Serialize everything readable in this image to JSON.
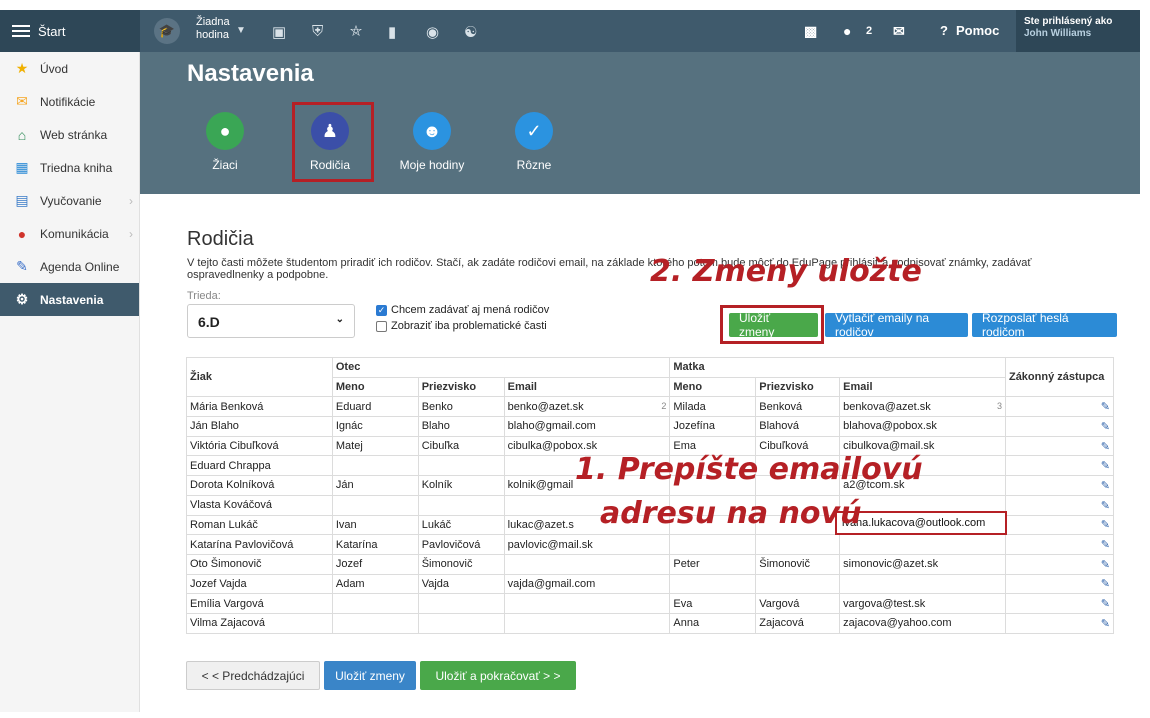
{
  "topbar": {
    "menu_label": "Štart",
    "hodina_line1": "Žiadna",
    "hodina_line2": "hodina",
    "messages_count": "2",
    "help_label": "Pomoc",
    "user_label": "Ste prihlásený ako",
    "user_name": "John Williams"
  },
  "sidebar": {
    "items": [
      {
        "label": "Úvod"
      },
      {
        "label": "Notifikácie"
      },
      {
        "label": "Web stránka"
      },
      {
        "label": "Triedna kniha"
      },
      {
        "label": "Vyučovanie"
      },
      {
        "label": "Komunikácia"
      },
      {
        "label": "Agenda Online"
      },
      {
        "label": "Nastavenia"
      }
    ]
  },
  "settings": {
    "title": "Nastavenia",
    "tabs": [
      {
        "label": "Žiaci"
      },
      {
        "label": "Rodičia"
      },
      {
        "label": "Moje hodiny"
      },
      {
        "label": "Rôzne"
      }
    ]
  },
  "content": {
    "heading": "Rodičia",
    "description": "V tejto časti môžete študentom priradiť ich rodičov. Stačí, ak zadáte rodičovi email, na základe ktorého potom bude môcť do EduPage prihlásiť a podpisovať známky, zadávať ospravedlnenky a podpobne.",
    "class_label": "Trieda:",
    "class_value": "6.D",
    "checkbox1": "Chcem zadávať aj mená rodičov",
    "checkbox2": "Zobraziť iba problematické časti",
    "btn_save": "Uložiť zmeny",
    "btn_print": "Vytlačiť emaily na rodičov",
    "btn_send": "Rozposlať heslá rodičom",
    "btn_prev": "< < Predchádzajúci",
    "btn_save_bottom": "Uložiť zmeny",
    "btn_save_continue": "Uložiť a pokračovať > >"
  },
  "table": {
    "h_student": "Žiak",
    "h_father": "Otec",
    "h_mother": "Matka",
    "h_guardian": "Zákonný zástupca",
    "h_name": "Meno",
    "h_surname": "Priezvisko",
    "h_email": "Email",
    "rows": [
      {
        "student": "Mária Benková",
        "f_name": "Eduard",
        "f_surname": "Benko",
        "f_email": "benko@azet.sk",
        "f_count": "2",
        "m_name": "Milada",
        "m_surname": "Benková",
        "m_email": "benkova@azet.sk",
        "m_count": "3"
      },
      {
        "student": "Ján Blaho",
        "f_name": "Ignác",
        "f_surname": "Blaho",
        "f_email": "blaho@gmail.com",
        "m_name": "Jozefína",
        "m_surname": "Blahová",
        "m_email": "blahova@pobox.sk"
      },
      {
        "student": "Viktória Cibuľková",
        "f_name": "Matej",
        "f_surname": "Cibuľka",
        "f_email": "cibulka@pobox.sk",
        "m_name": "Ema",
        "m_surname": "Cibuľková",
        "m_email": "cibulkova@mail.sk"
      },
      {
        "student": "Eduard Chrappa"
      },
      {
        "student": "Dorota Kolníková",
        "f_name": "Ján",
        "f_surname": "Kolník",
        "f_email": "kolnik@gmail",
        "m_email": "a2@tcom.sk"
      },
      {
        "student": "Vlasta Kováčová"
      },
      {
        "student": "Roman Lukáč",
        "f_name": "Ivan",
        "f_surname": "Lukáč",
        "f_email": "lukac@azet.s"
      },
      {
        "student": "Katarína Pavlovičová",
        "f_name": "Katarína",
        "f_surname": "Pavlovičová",
        "f_email": "pavlovic@mail.sk"
      },
      {
        "student": "Oto Šimonovič",
        "f_name": "Jozef",
        "f_surname": "Šimonovič",
        "m_name": "Peter",
        "m_surname": "Šimonovič",
        "m_email": "simonovic@azet.sk"
      },
      {
        "student": "Jozef Vajda",
        "f_name": "Adam",
        "f_surname": "Vajda",
        "f_email": "vajda@gmail.com"
      },
      {
        "student": "Emília Vargová",
        "m_name": "Eva",
        "m_surname": "Vargová",
        "m_email": "vargova@test.sk"
      },
      {
        "student": "Vilma Zajacová",
        "m_name": "Anna",
        "m_surname": "Zajacová",
        "m_email": "zajacova@yahoo.com"
      }
    ],
    "edited_email": "ivana.lukacova@outlook.com"
  },
  "annotations": {
    "step2": "2. Zmeny uložte",
    "step1_line1": "1. Prepíšte emailovú",
    "step1_line2": "adresu na novú"
  },
  "colors": {
    "topbar": "#3f5a6c",
    "header": "#56717f",
    "annotation_red": "#b52025",
    "save_green": "#4aa84a",
    "action_blue": "#2c8bd6"
  }
}
